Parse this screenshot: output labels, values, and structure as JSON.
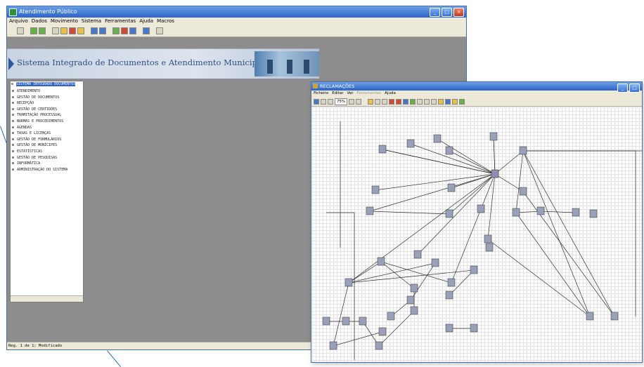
{
  "main_window": {
    "title": "Atendimento Público",
    "menu": [
      "Arquivo",
      "Dados",
      "Movimento",
      "Sistema",
      "Ferramentas",
      "Ajuda",
      "Macros"
    ],
    "banner_title": "Sistema Integrado de Documentos e Atendimento Municipal",
    "tree": {
      "root": "SISTEMA INTEGRADO DOCUMENTOS",
      "items": [
        "ATENDIMENTO",
        "GESTÃO DE DOCUMENTOS",
        "RECEPÇÃO",
        "GESTÃO DE CERTIDÕES",
        "TRAMITAÇÃO PROCESSUAL",
        "NORMAS E PROCEDIMENTOS",
        "AGENDAS",
        "TAXAS E LICENÇAS",
        "GESTÃO DE FORMULÁRIOS",
        "GESTÃO DE MUNÍCIPES",
        "ESTATÍSTICAS",
        "GESTÃO DE PESQUISAS",
        "INFORMÁTICA",
        "ADMINISTRAÇÃO DO SISTEMA"
      ]
    },
    "status": "Reg. 1 de 1; Modificado"
  },
  "workflow_window": {
    "title": "RECLAMAÇÕES",
    "menu": [
      "Ficheiro",
      "Editar",
      "Ver",
      "Ferramentas",
      "Ajuda"
    ],
    "zoom": "75%"
  },
  "colors": {
    "titlebar": "#2c63c7",
    "workspace": "#8d8d8d",
    "tree_selection": "#3163c5",
    "banner_text": "#2e4f86"
  }
}
